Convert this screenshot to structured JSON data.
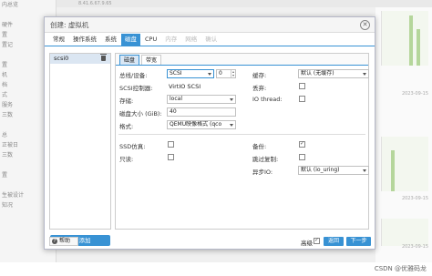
{
  "background": {
    "top_text": "8.41.6.67.9.65",
    "sidebar_rows": [
      "内总览",
      "",
      "硬件",
      "置",
      "置记",
      "",
      "置",
      "机",
      "档",
      "式",
      "服务",
      "三数",
      "",
      "总",
      "正被日",
      "三数",
      "",
      "置",
      "",
      "生被设计",
      "知况"
    ],
    "stamps": [
      "2023-09-15",
      "2023-09-15",
      "2023-09-15"
    ],
    "watermark": "CSDN @优雅码龙"
  },
  "dialog": {
    "title": "创建: 虚拟机",
    "tabs": [
      {
        "label": "常规",
        "state": "normal"
      },
      {
        "label": "操作系统",
        "state": "normal"
      },
      {
        "label": "系统",
        "state": "normal"
      },
      {
        "label": "磁盘",
        "state": "active"
      },
      {
        "label": "CPU",
        "state": "normal"
      },
      {
        "label": "内存",
        "state": "disabled"
      },
      {
        "label": "网络",
        "state": "disabled"
      },
      {
        "label": "确认",
        "state": "disabled"
      }
    ],
    "disks": [
      {
        "label": "scsi0"
      }
    ],
    "add_button": "添加",
    "subtabs": [
      "磁盘",
      "带宽"
    ],
    "fields": {
      "bus_label": "总线/设备:",
      "bus_value": "SCSI",
      "device_index": "0",
      "controller_label": "SCSI控制器:",
      "controller_value": "VirtIO SCSI",
      "storage_label": "存储:",
      "storage_value": "local",
      "disk_size_label": "磁盘大小 (GiB):",
      "disk_size_value": "40",
      "format_label": "格式:",
      "format_value": "QEMU映像格式 (qco",
      "cache_label": "缓存:",
      "cache_value": "默认 (无缓存)",
      "discard_label": "丢弃:",
      "iothread_label": "IO thread:",
      "ssd_label": "SSD仿真:",
      "readonly_label": "只读:",
      "backup_label": "备份:",
      "skip_replication_label": "跳过复制:",
      "async_io_label": "异步IO:",
      "async_io_value": "默认 (io_uring)"
    },
    "footer": {
      "help": "帮助",
      "advanced": "高级",
      "back": "返回",
      "next": "下一步"
    }
  }
}
